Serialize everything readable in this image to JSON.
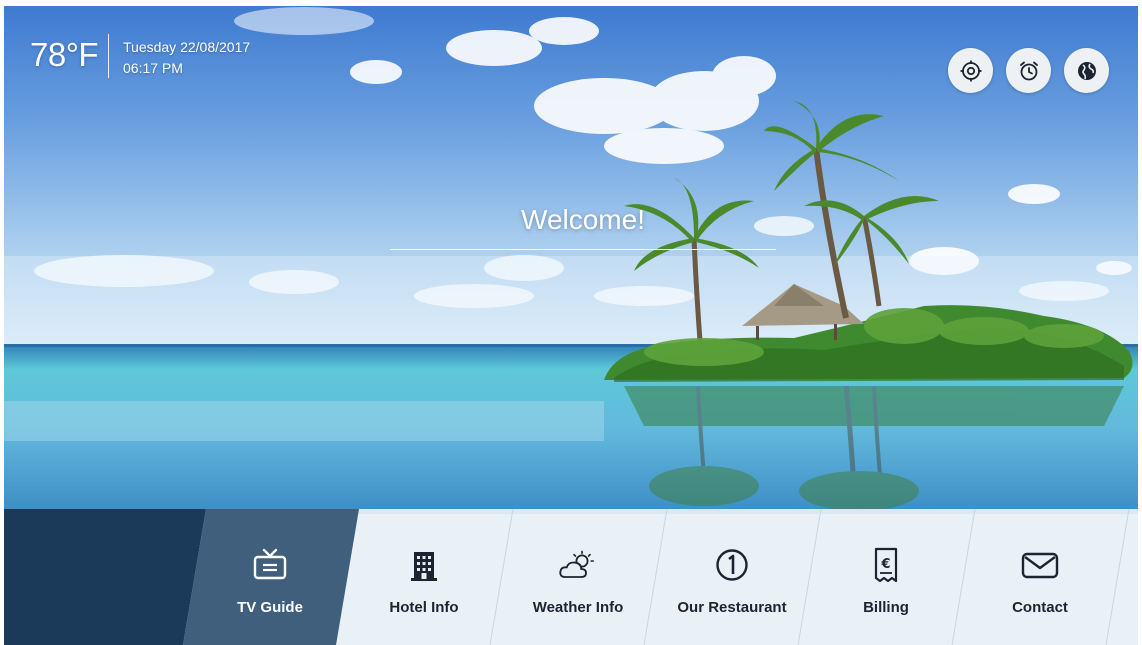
{
  "status": {
    "temperature": "78°F",
    "date": "Tuesday 22/08/2017",
    "time": "06:17 PM"
  },
  "top_icons": [
    {
      "name": "target-icon"
    },
    {
      "name": "alarm-clock-icon"
    },
    {
      "name": "globe-icon"
    }
  ],
  "welcome": "Welcome!",
  "menu": [
    {
      "label": "TV Guide",
      "icon": "tv-icon",
      "active": true
    },
    {
      "label": "Hotel Info",
      "icon": "building-icon",
      "active": false
    },
    {
      "label": "Weather Info",
      "icon": "weather-icon",
      "active": false
    },
    {
      "label": "Our Restaurant",
      "icon": "restaurant-icon",
      "active": false
    },
    {
      "label": "Billing",
      "icon": "bill-icon",
      "active": false
    },
    {
      "label": "Contact",
      "icon": "mail-icon",
      "active": false
    }
  ],
  "colors": {
    "menu_dark": "#1b3a5a",
    "menu_active": "#3f5f7c",
    "menu_light": "#e7eff5",
    "icon_dark": "#1b2430"
  }
}
